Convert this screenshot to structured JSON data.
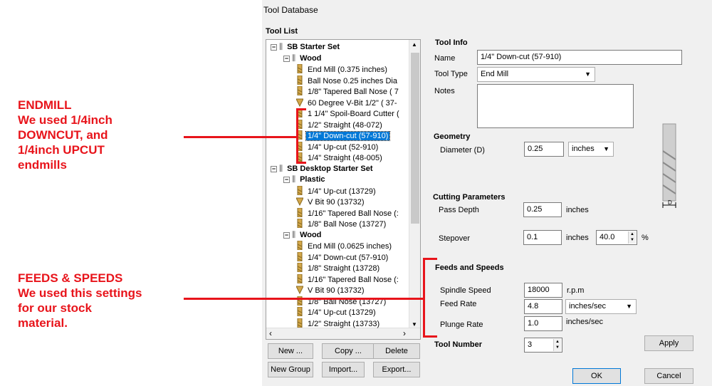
{
  "annotations": {
    "endmill": [
      "ENDMILL",
      "We used 1/4inch",
      "DOWNCUT, and",
      "1/4inch UPCUT",
      "endmills"
    ],
    "feeds": [
      "FEEDS & SPEEDS",
      "We used this settings",
      "for our stock",
      "material."
    ]
  },
  "dialog": {
    "title": "Tool Database",
    "tool_list_label": "Tool List",
    "tree": [
      {
        "label": "SB Starter Set",
        "bold": true,
        "level": 0,
        "kind": "group"
      },
      {
        "label": "Wood",
        "bold": true,
        "level": 1,
        "kind": "group"
      },
      {
        "label": "End Mill (0.375 inches)",
        "level": 2,
        "kind": "tool"
      },
      {
        "label": "Ball Nose 0.25 inches Dia",
        "level": 2,
        "kind": "tool"
      },
      {
        "label": "1/8\" Tapered Ball Nose ( 7",
        "level": 2,
        "kind": "tool"
      },
      {
        "label": "60 Degree V-Bit 1/2\"  ( 37-",
        "level": 2,
        "kind": "vbit"
      },
      {
        "label": "1 1/4\" Spoil-Board Cutter (",
        "level": 2,
        "kind": "tool"
      },
      {
        "label": "1/2\" Straight  (48-072)",
        "level": 2,
        "kind": "tool"
      },
      {
        "label": "1/4\"  Down-cut (57-910)",
        "level": 2,
        "kind": "tool",
        "selected": true
      },
      {
        "label": "1/4\" Up-cut (52-910)",
        "level": 2,
        "kind": "tool"
      },
      {
        "label": "1/4\" Straight  (48-005)",
        "level": 2,
        "kind": "tool"
      },
      {
        "label": "SB Desktop Starter Set",
        "bold": true,
        "level": 0,
        "kind": "group"
      },
      {
        "label": "Plastic",
        "bold": true,
        "level": 1,
        "kind": "group"
      },
      {
        "label": "1/4\" Up-cut (13729)",
        "level": 2,
        "kind": "tool"
      },
      {
        "label": "V Bit 90 (13732)",
        "level": 2,
        "kind": "vbit"
      },
      {
        "label": "1/16\" Tapered Ball Nose (:",
        "level": 2,
        "kind": "tool"
      },
      {
        "label": "1/8\" Ball Nose (13727)",
        "level": 2,
        "kind": "tool"
      },
      {
        "label": "Wood",
        "bold": true,
        "level": 1,
        "kind": "group"
      },
      {
        "label": "End Mill (0.0625 inches)",
        "level": 2,
        "kind": "tool"
      },
      {
        "label": "1/4\"  Down-cut (57-910)",
        "level": 2,
        "kind": "tool"
      },
      {
        "label": "1/8\" Straight (13728)",
        "level": 2,
        "kind": "tool"
      },
      {
        "label": "1/16\" Tapered Ball Nose (:",
        "level": 2,
        "kind": "tool"
      },
      {
        "label": "V Bit 90 (13732)",
        "level": 2,
        "kind": "vbit"
      },
      {
        "label": "1/8\" Ball Nose (13727)",
        "level": 2,
        "kind": "tool"
      },
      {
        "label": "1/4\" Up-cut (13729)",
        "level": 2,
        "kind": "tool"
      },
      {
        "label": "1/2\" Straight (13733)",
        "level": 2,
        "kind": "tool"
      }
    ],
    "buttons": {
      "new": "New ...",
      "copy": "Copy ...",
      "delete": "Delete",
      "new_group": "New Group",
      "import": "Import...",
      "export": "Export...",
      "apply": "Apply",
      "ok": "OK",
      "cancel": "Cancel"
    },
    "tool_info": {
      "header": "Tool Info",
      "name_label": "Name",
      "name_value": "1/4\"  Down-cut (57-910)",
      "type_label": "Tool Type",
      "type_value": "End Mill",
      "notes_label": "Notes",
      "notes_value": ""
    },
    "geometry": {
      "header": "Geometry",
      "diameter_label": "Diameter (D)",
      "diameter_value": "0.25",
      "diameter_unit": "inches"
    },
    "cutting": {
      "header": "Cutting Parameters",
      "pass_depth_label": "Pass Depth",
      "pass_depth_value": "0.25",
      "pass_depth_unit": "inches",
      "stepover_label": "Stepover",
      "stepover_value": "0.1",
      "stepover_unit": "inches",
      "stepover_pct": "40.0",
      "pct_sign": "%"
    },
    "feeds": {
      "header": "Feeds and Speeds",
      "spindle_label": "Spindle Speed",
      "spindle_value": "18000",
      "spindle_unit": "r.p.m",
      "feed_label": "Feed Rate",
      "feed_value": "4.8",
      "feed_unit": "inches/sec",
      "plunge_label": "Plunge Rate",
      "plunge_value": "1.0",
      "plunge_unit": "inches/sec"
    },
    "tool_number": {
      "label": "Tool Number",
      "value": "3"
    },
    "diagram_label": "D"
  },
  "colors": {
    "annotation": "#e8141b",
    "selection": "#0078d7"
  }
}
